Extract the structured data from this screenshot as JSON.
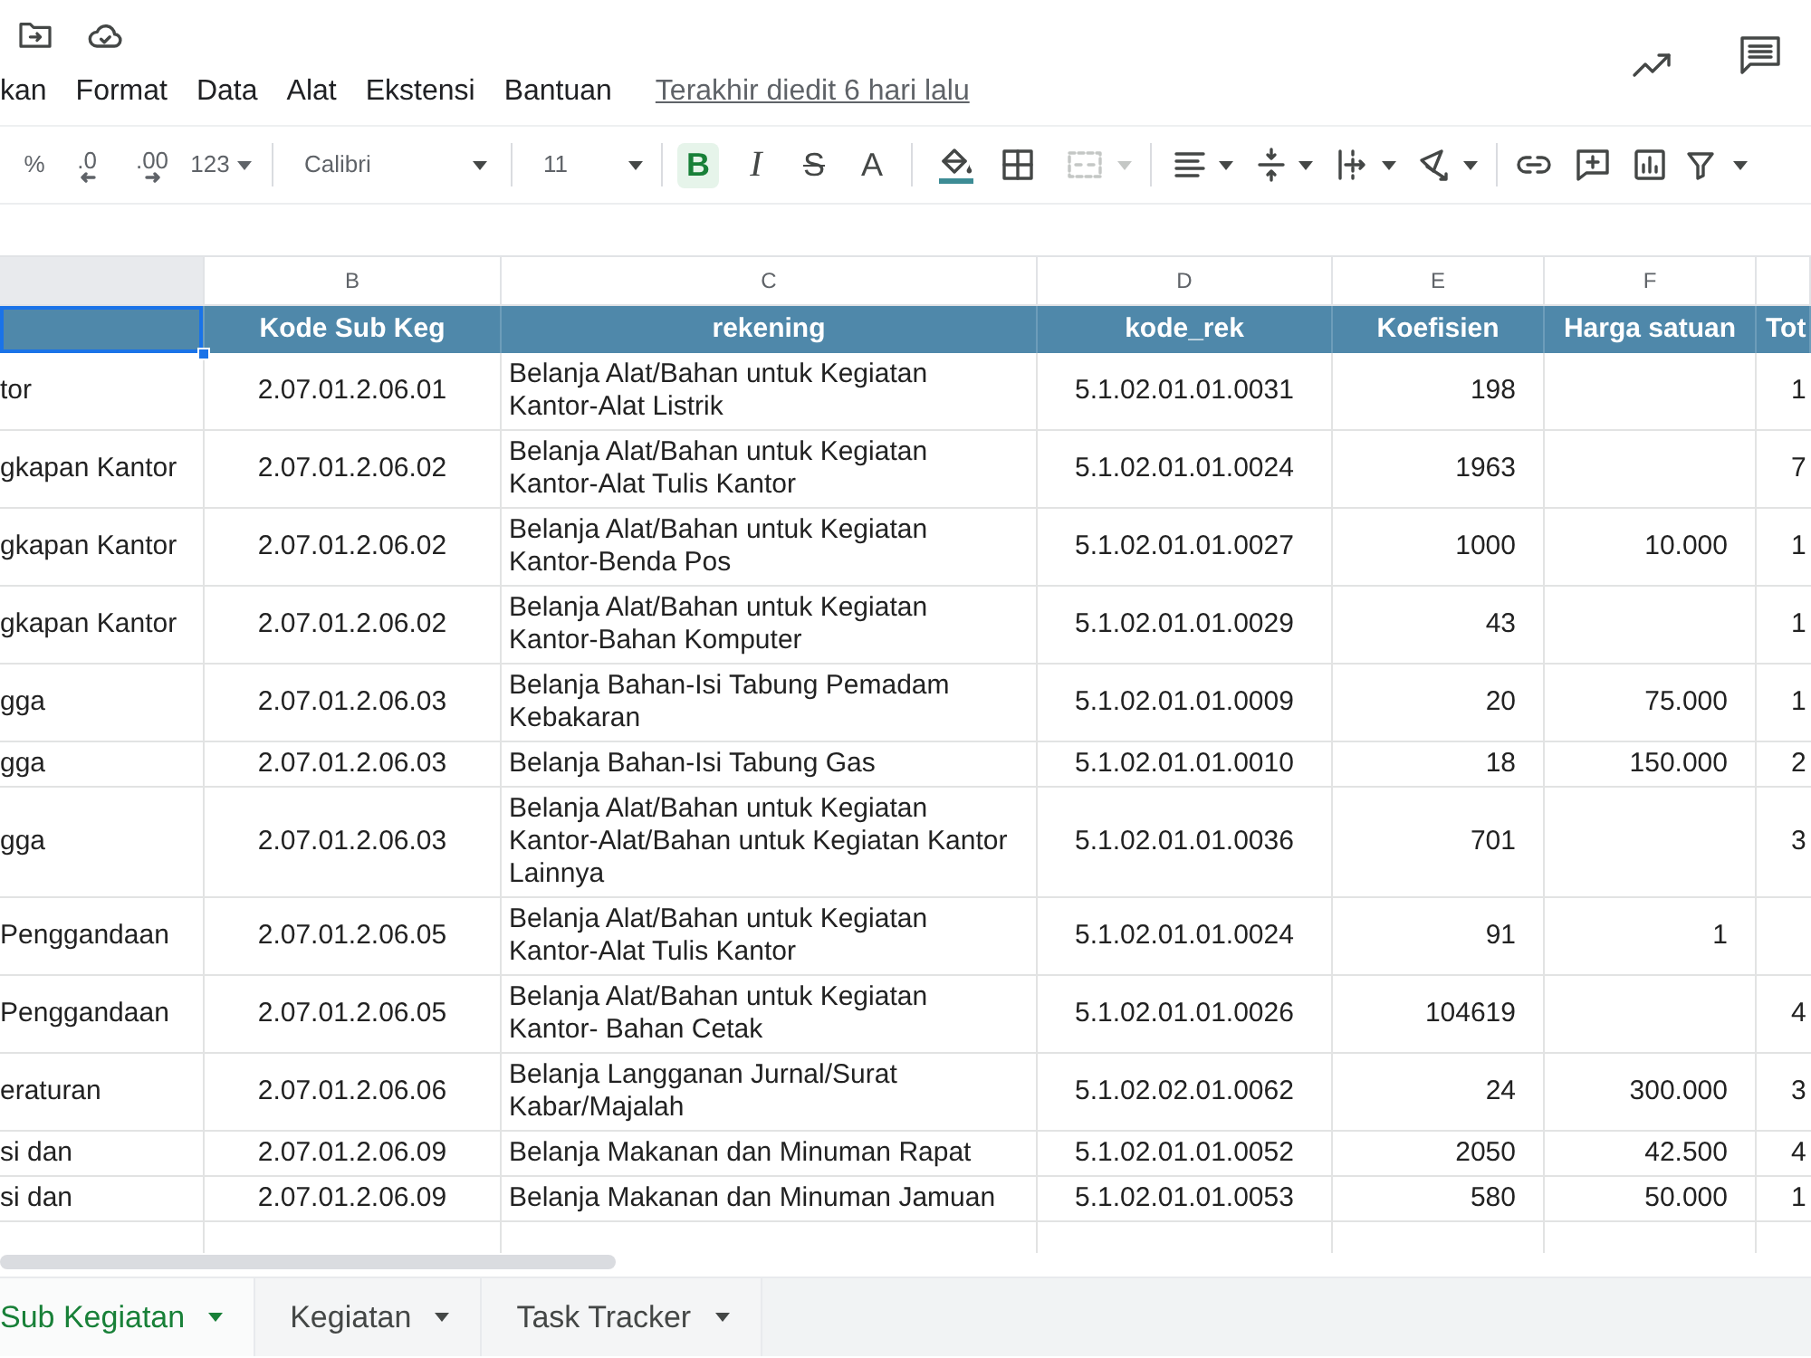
{
  "menu_bar": {
    "items": [
      "kan",
      "Format",
      "Data",
      "Alat",
      "Ekstensi",
      "Bantuan"
    ],
    "last_edit": "Terakhir diedit 6 hari lalu"
  },
  "toolbar": {
    "number_formats": [
      {
        "kind": "percent",
        "label": "%"
      },
      {
        "kind": "decrease_decimals",
        "label": ".0"
      },
      {
        "kind": "increase_decimals",
        "label": ".00"
      },
      {
        "kind": "more_formats",
        "label": "123"
      }
    ],
    "font": "Calibri",
    "font_size": "11",
    "text_styles": [
      {
        "kind": "bold",
        "label": "B",
        "on": true
      },
      {
        "kind": "italic",
        "label": "I",
        "on": false
      },
      {
        "kind": "strikethrough",
        "label": "S",
        "on": false
      },
      {
        "kind": "text_color",
        "label": "A",
        "on": false
      }
    ],
    "merge_cells": {
      "disabled": true
    }
  },
  "sheet": {
    "column_letters": [
      "B",
      "C",
      "D",
      "E",
      "F"
    ],
    "header_row": [
      {
        "selected": true
      },
      {
        "text": "Kode Sub Keg",
        "selected": false
      },
      {
        "text": "rekening",
        "selected": false
      },
      {
        "text": "kode_rek",
        "selected": false
      },
      {
        "text": "Koefisien",
        "selected": false
      },
      {
        "text": "Harga satuan",
        "selected": false
      },
      {
        "text": "Tot",
        "selected": false
      }
    ],
    "rows": [
      {
        "column_a": "tor",
        "kode_sub_keg": "2.07.01.2.06.01",
        "rekening": "Belanja Alat/Bahan untuk Kegiatan Kantor-Alat Listrik",
        "kode_rek": "5.1.02.01.01.0031",
        "koefisien": "198",
        "column_g": "1"
      },
      {
        "column_a": "gkapan Kantor",
        "kode_sub_keg": "2.07.01.2.06.02",
        "rekening": "Belanja Alat/Bahan untuk Kegiatan Kantor-Alat Tulis Kantor",
        "kode_rek": "5.1.02.01.01.0024",
        "koefisien": "1963",
        "column_g": "7"
      },
      {
        "column_a": "gkapan Kantor",
        "kode_sub_keg": "2.07.01.2.06.02",
        "rekening": "Belanja Alat/Bahan untuk Kegiatan Kantor-Benda Pos",
        "kode_rek": "5.1.02.01.01.0027",
        "koefisien": "1000",
        "harga_satuan": "10.000",
        "column_g": "1"
      },
      {
        "column_a": "gkapan Kantor",
        "kode_sub_keg": "2.07.01.2.06.02",
        "rekening": "Belanja Alat/Bahan untuk Kegiatan Kantor-Bahan Komputer",
        "kode_rek": "5.1.02.01.01.0029",
        "koefisien": "43",
        "column_g": "1"
      },
      {
        "column_a": "gga",
        "kode_sub_keg": "2.07.01.2.06.03",
        "rekening": "Belanja Bahan-Isi Tabung Pemadam Kebakaran",
        "kode_rek": "5.1.02.01.01.0009",
        "koefisien": "20",
        "harga_satuan": "75.000",
        "column_g": "1"
      },
      {
        "column_a": "gga",
        "kode_sub_keg": "2.07.01.2.06.03",
        "rekening": "Belanja Bahan-Isi Tabung Gas",
        "kode_rek": "5.1.02.01.01.0010",
        "koefisien": "18",
        "harga_satuan": "150.000",
        "column_g": "2"
      },
      {
        "column_a": "gga",
        "kode_sub_keg": "2.07.01.2.06.03",
        "rekening": "Belanja Alat/Bahan untuk Kegiatan Kantor-Alat/Bahan untuk Kegiatan Kantor Lainnya",
        "kode_rek": "5.1.02.01.01.0036",
        "koefisien": "701",
        "column_g": "3"
      },
      {
        "column_a": "Penggandaan",
        "kode_sub_keg": "2.07.01.2.06.05",
        "rekening": "Belanja Alat/Bahan untuk Kegiatan Kantor-Alat Tulis Kantor",
        "kode_rek": "5.1.02.01.01.0024",
        "koefisien": "91",
        "harga_satuan": "1"
      },
      {
        "column_a": "Penggandaan",
        "kode_sub_keg": "2.07.01.2.06.05",
        "rekening": "Belanja Alat/Bahan untuk Kegiatan Kantor- Bahan Cetak",
        "kode_rek": "5.1.02.01.01.0026",
        "koefisien": "104619",
        "column_g": "4"
      },
      {
        "column_a": "eraturan",
        "kode_sub_keg": "2.07.01.2.06.06",
        "rekening": "Belanja Langganan Jurnal/Surat Kabar/Majalah",
        "kode_rek": "5.1.02.02.01.0062",
        "koefisien": "24",
        "harga_satuan": "300.000",
        "column_g": "3"
      },
      {
        "column_a": "si dan",
        "kode_sub_keg": "2.07.01.2.06.09",
        "rekening": "Belanja Makanan dan Minuman Rapat",
        "kode_rek": "5.1.02.01.01.0052",
        "koefisien": "2050",
        "harga_satuan": "42.500",
        "column_g": "4"
      },
      {
        "column_a": "si dan",
        "kode_sub_keg": "2.07.01.2.06.09",
        "rekening": "Belanja Makanan dan Minuman Jamuan",
        "kode_rek": "5.1.02.01.01.0053",
        "koefisien": "580",
        "harga_satuan": "50.000",
        "column_g": "1"
      }
    ]
  },
  "sheet_tabs": [
    {
      "label": "Sub Kegiatan",
      "selected": true
    },
    {
      "label": "Kegiatan",
      "selected": false
    },
    {
      "label": "Task Tracker",
      "selected": false
    }
  ]
}
